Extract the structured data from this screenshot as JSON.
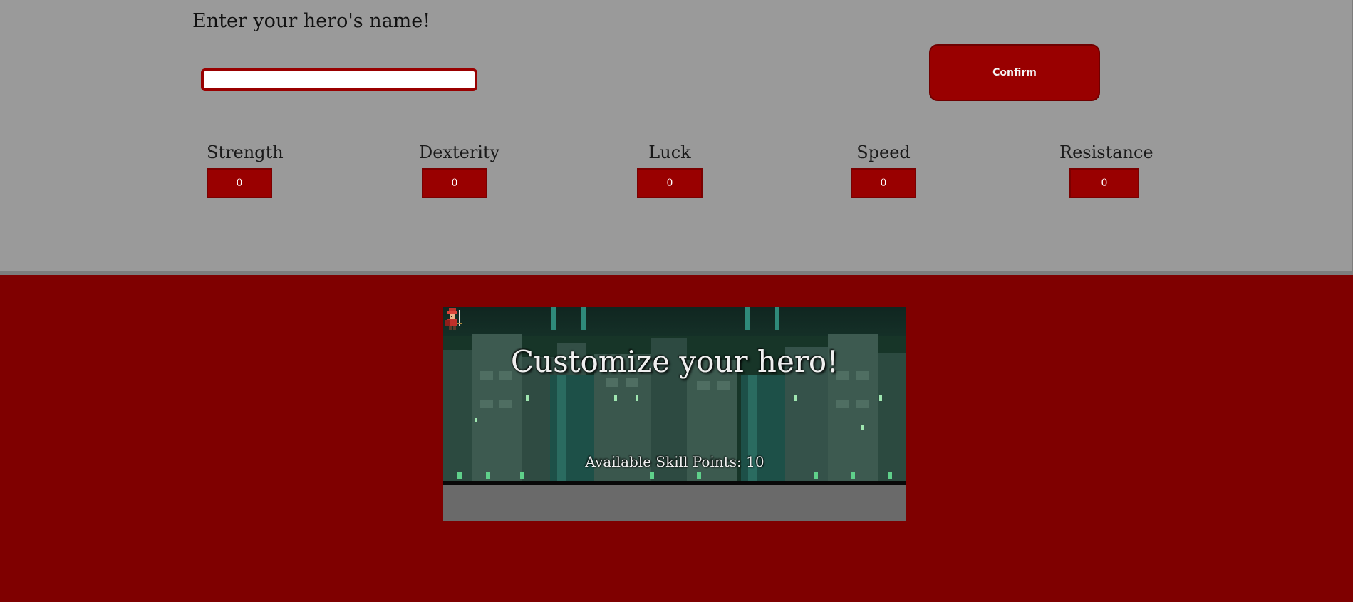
{
  "name_prompt": "Enter your hero's name!",
  "name_input": {
    "value": "",
    "placeholder": ""
  },
  "confirm_label": "Confirm",
  "stats": [
    {
      "label": "Strength",
      "value": "0"
    },
    {
      "label": "Dexterity",
      "value": "0"
    },
    {
      "label": "Luck",
      "value": "0"
    },
    {
      "label": "Speed",
      "value": "0"
    },
    {
      "label": "Resistance",
      "value": "0"
    }
  ],
  "banner": {
    "title": "Customize your hero!",
    "skill_points": "Available Skill Points: 10"
  },
  "colors": {
    "accent": "#990000",
    "background": "#7f0000",
    "panel": "#9a9a9a"
  }
}
